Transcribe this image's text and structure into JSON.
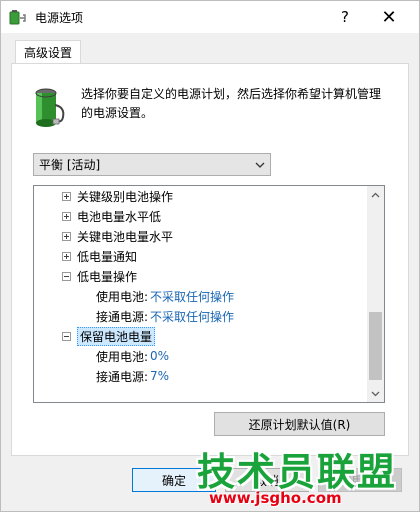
{
  "window": {
    "title": "电源选项",
    "help_label": "?",
    "close_label": "✕"
  },
  "tabs": [
    {
      "label": "高级设置"
    }
  ],
  "description": "选择你要自定义的电源计划，然后选择你希望计算机管理的电源设置。",
  "plan": {
    "selected": "平衡 [活动]"
  },
  "tree": {
    "items": [
      {
        "label": "关键级别电池操作",
        "expander": "+"
      },
      {
        "label": "电池电量水平低",
        "expander": "+"
      },
      {
        "label": "关键电池电量水平",
        "expander": "+"
      },
      {
        "label": "低电量通知",
        "expander": "+"
      },
      {
        "label": "低电量操作",
        "expander": "−",
        "children": [
          {
            "label": "使用电池:",
            "value": "不采取任何操作"
          },
          {
            "label": "接通电源:",
            "value": "不采取任何操作"
          }
        ]
      },
      {
        "label": "保留电池电量",
        "expander": "−",
        "selected": true,
        "children": [
          {
            "label": "使用电池:",
            "value": "0%"
          },
          {
            "label": "接通电源:",
            "value": "7%"
          }
        ]
      }
    ]
  },
  "buttons": {
    "restore": "还原计划默认值(R)",
    "ok": "确定",
    "cancel": "取消",
    "apply": "应用(A)"
  },
  "watermark": {
    "title": "技术员联盟",
    "url": "www.jsgho.com"
  },
  "colors": {
    "link": "#1a66b3",
    "selection": "#cce8ff",
    "watermark_green": "#1aa33a",
    "watermark_red": "#e60012"
  }
}
